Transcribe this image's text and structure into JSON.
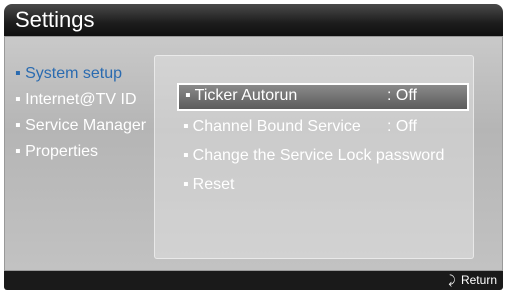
{
  "header": {
    "title": "Settings"
  },
  "sidebar": {
    "items": [
      {
        "label": "▪ System setup"
      },
      {
        "label": "▪ Internet@TV ID"
      },
      {
        "label": "▪ Service Manager"
      },
      {
        "label": "▪ Properties"
      }
    ]
  },
  "options": [
    {
      "label": "Ticker Autorun",
      "value": ": Off"
    },
    {
      "label": "Channel Bound Service",
      "value": ": Off"
    },
    {
      "label": "Change the Service Lock password",
      "value": ""
    },
    {
      "label": "Reset",
      "value": ""
    }
  ],
  "footer": {
    "return_label": "Return",
    "return_icon": "⤸"
  },
  "colors": {
    "active_menu": "#2a6bb0",
    "footer_bg": "#1a1a1a"
  },
  "bullet": "▪"
}
